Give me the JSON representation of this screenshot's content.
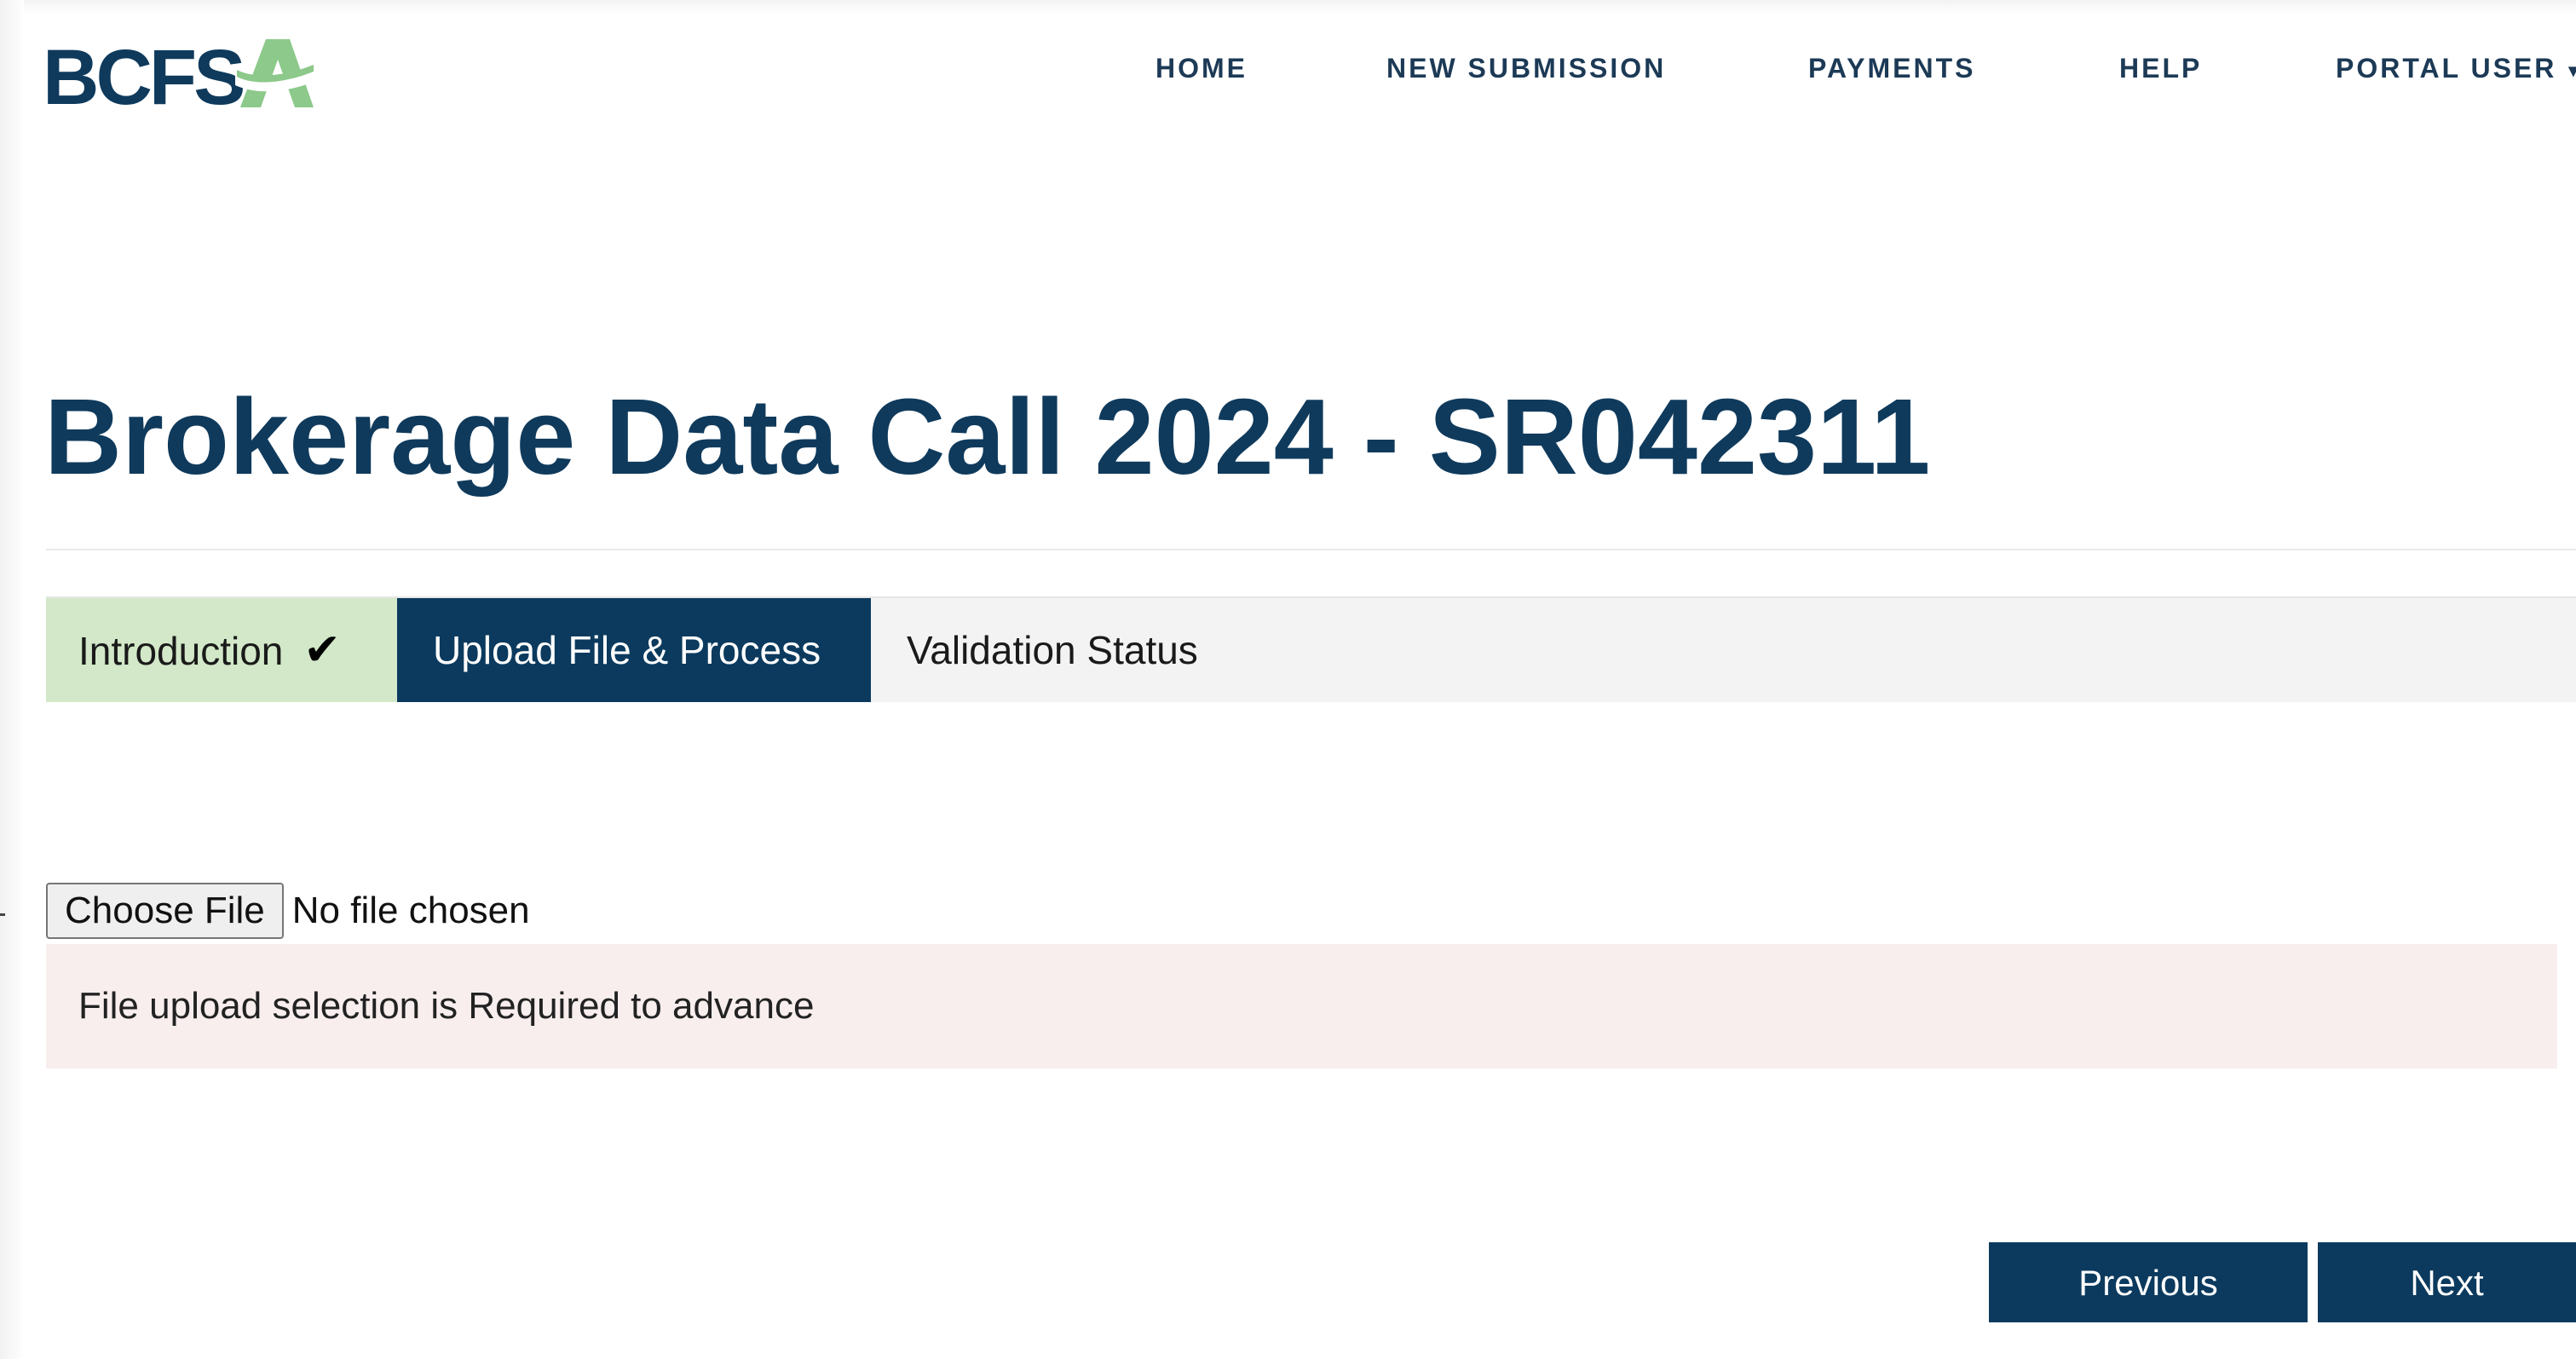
{
  "header": {
    "logo_text": "BCFSA",
    "nav": {
      "home": "HOME",
      "new_submission": "NEW SUBMISSION",
      "payments": "PAYMENTS",
      "help": "HELP",
      "user": "PORTAL USER"
    }
  },
  "main": {
    "title": "Brokerage Data Call 2024 - SR042311",
    "steps": [
      {
        "label": "Introduction",
        "state": "completed",
        "icon": "checkmark-icon"
      },
      {
        "label": "Upload File & Process",
        "state": "active"
      },
      {
        "label": "Validation Status",
        "state": "pending"
      }
    ],
    "file_input": {
      "button_label": "Choose File",
      "status": "No file chosen"
    },
    "error_message": "File upload selection is Required to advance",
    "buttons": {
      "previous": "Previous",
      "next": "Next"
    }
  },
  "colors": {
    "brand_navy": "#0b3a5e",
    "brand_green": "#8cc98a",
    "step_complete_bg": "#d2e8c8",
    "error_bg": "#f8eeee"
  }
}
